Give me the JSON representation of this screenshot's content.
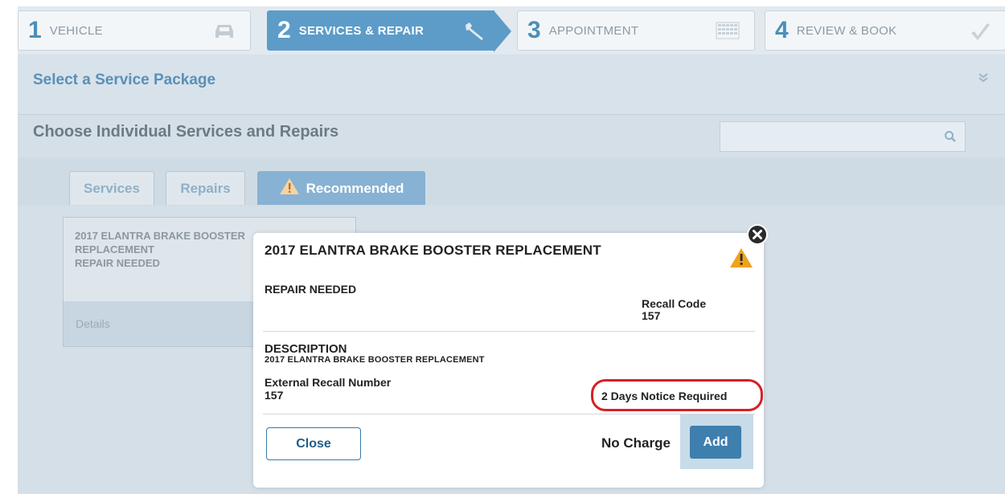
{
  "steps": [
    {
      "num": "1",
      "label": "VEHICLE",
      "icon": "car-icon"
    },
    {
      "num": "2",
      "label": "SERVICES & REPAIR",
      "icon": "wrench-icon"
    },
    {
      "num": "3",
      "label": "APPOINTMENT",
      "icon": "calendar-icon"
    },
    {
      "num": "4",
      "label": "REVIEW & BOOK",
      "icon": "checkmark-icon"
    }
  ],
  "package": {
    "title": "Select a Service Package"
  },
  "individual": {
    "title": "Choose Individual Services and Repairs",
    "search_placeholder": ""
  },
  "tabs": [
    "Services",
    "Repairs",
    "Recommended"
  ],
  "card": {
    "line1": "2017 ELANTRA BRAKE BOOSTER",
    "line2": "REPLACEMENT",
    "line3": "REPAIR NEEDED",
    "details": "Details"
  },
  "modal": {
    "title": "2017 ELANTRA BRAKE BOOSTER REPLACEMENT",
    "status": "REPAIR NEEDED",
    "recall_code_label": "Recall Code",
    "recall_code_value": "157",
    "description_label": "DESCRIPTION",
    "description_value": "2017 ELANTRA BRAKE BOOSTER REPLACEMENT",
    "external_label": "External Recall Number",
    "external_value": "157",
    "notice": "2 Days Notice Required",
    "close_label": "Close",
    "charge": "No Charge",
    "add_label": "Add"
  },
  "colors": {
    "accent": "#3e7fae",
    "warning": "#f0a21c",
    "highlight": "#d61f26"
  }
}
